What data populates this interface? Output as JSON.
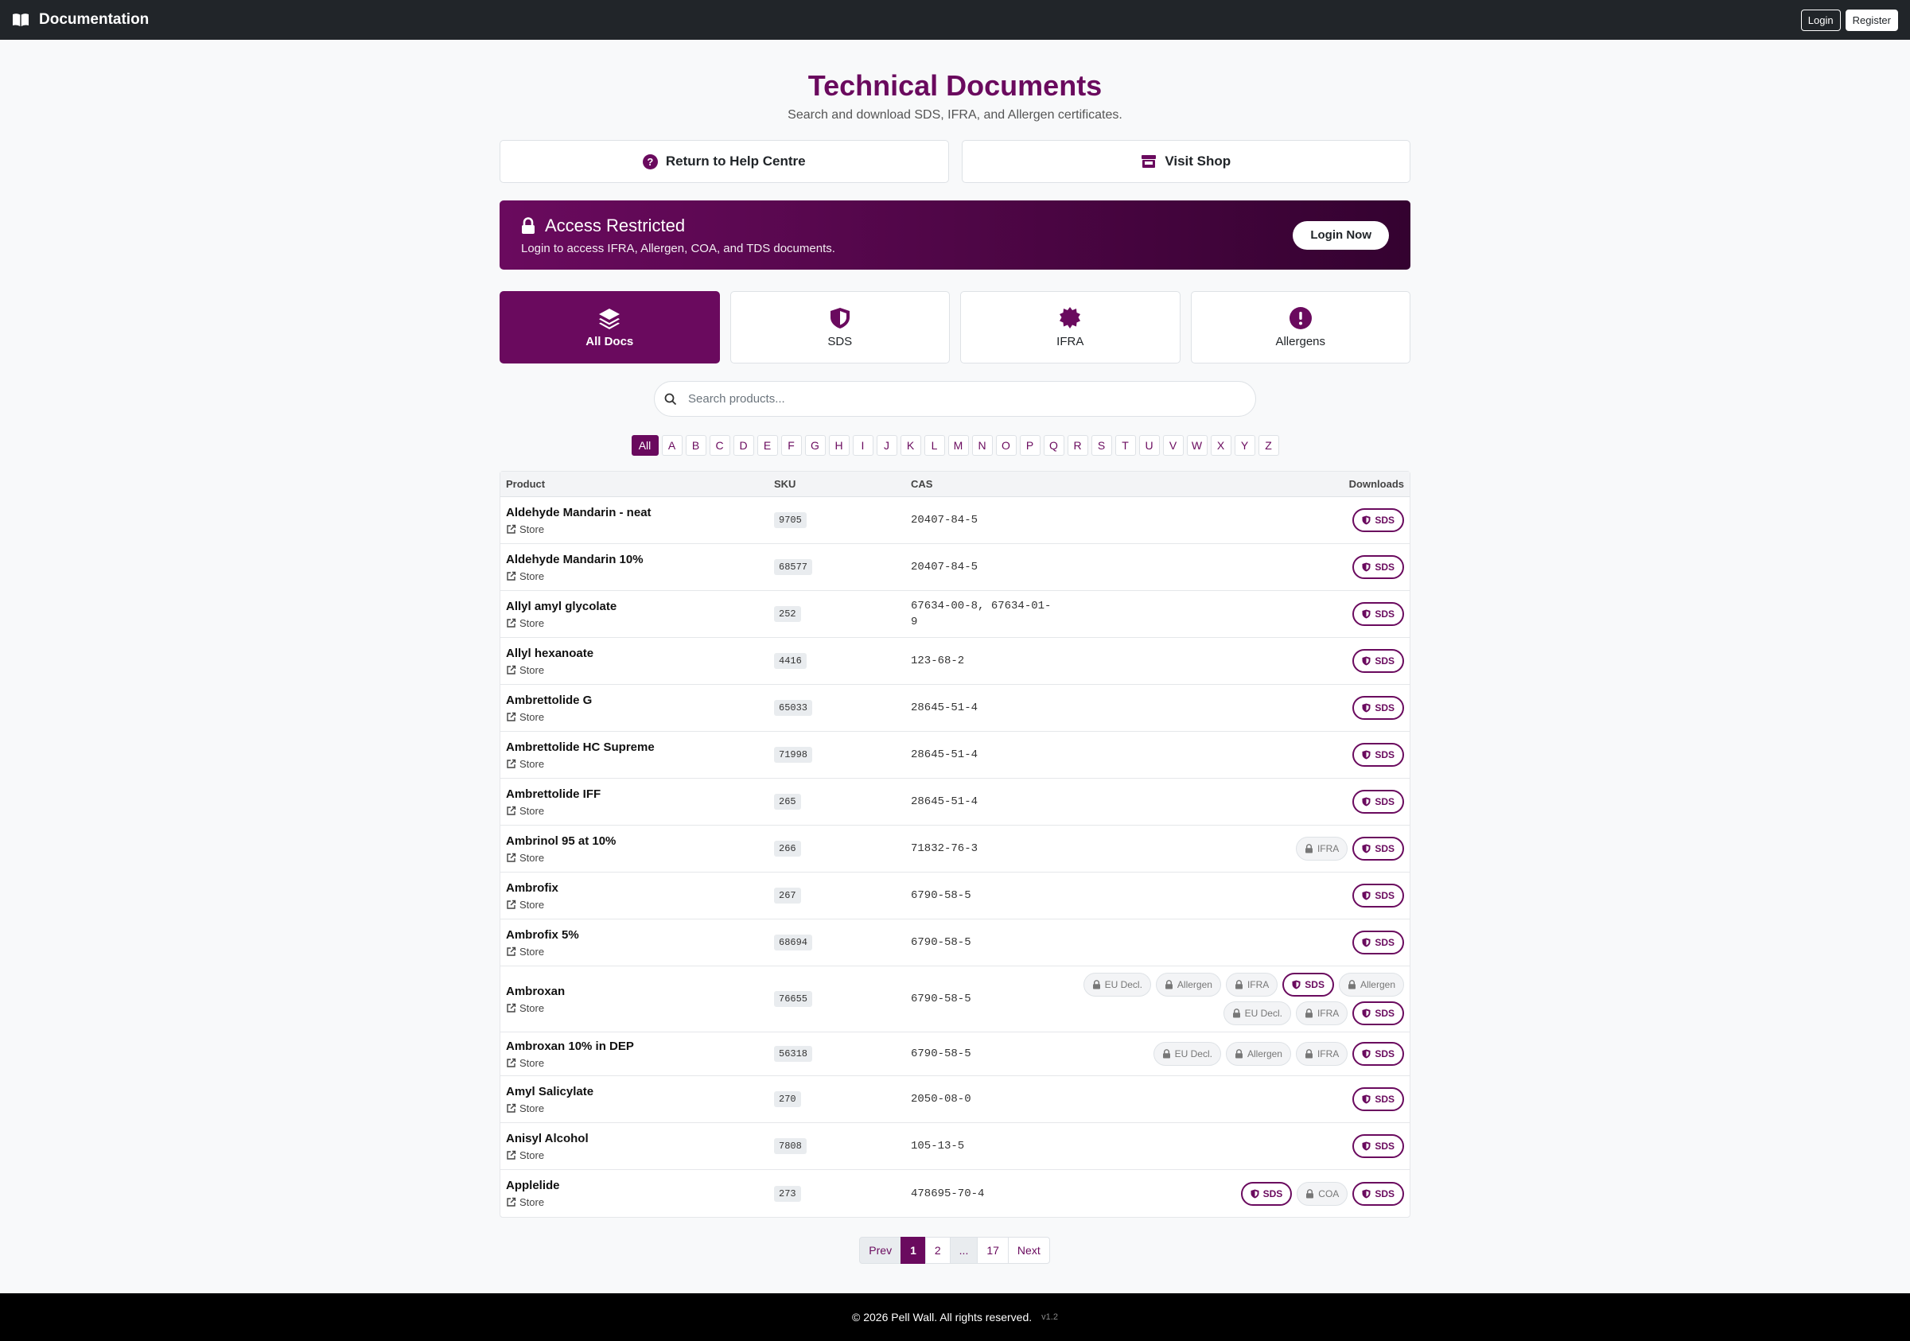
{
  "topbar": {
    "title": "Documentation",
    "login": "Login",
    "register": "Register"
  },
  "header": {
    "title": "Technical Documents",
    "subtitle": "Search and download SDS, IFRA, and Allergen certificates."
  },
  "quick_links": {
    "help": "Return to Help Centre",
    "shop": "Visit Shop"
  },
  "alert": {
    "title": "Access Restricted",
    "text": "Login to access IFRA, Allergen, COA, and TDS documents.",
    "button": "Login Now"
  },
  "doc_tabs": [
    {
      "label": "All Docs",
      "icon": "layers-icon",
      "active": true
    },
    {
      "label": "SDS",
      "icon": "shield-icon",
      "active": false
    },
    {
      "label": "IFRA",
      "icon": "certificate-icon",
      "active": false
    },
    {
      "label": "Allergens",
      "icon": "exclamation-icon",
      "active": false
    }
  ],
  "search": {
    "placeholder": "Search products..."
  },
  "alphabet": [
    "All",
    "A",
    "B",
    "C",
    "D",
    "E",
    "F",
    "G",
    "H",
    "I",
    "J",
    "K",
    "L",
    "M",
    "N",
    "O",
    "P",
    "Q",
    "R",
    "S",
    "T",
    "U",
    "V",
    "W",
    "X",
    "Y",
    "Z"
  ],
  "table": {
    "headers": {
      "product": "Product",
      "sku": "SKU",
      "cas": "CAS",
      "downloads": "Downloads"
    },
    "store_label": "Store",
    "rows": [
      {
        "name": "Aldehyde Mandarin - neat",
        "sku": "9705",
        "cas": "20407-84-5",
        "downloads": [
          "SDS"
        ]
      },
      {
        "name": "Aldehyde Mandarin 10%",
        "sku": "68577",
        "cas": "20407-84-5",
        "downloads": [
          "SDS"
        ]
      },
      {
        "name": "Allyl amyl glycolate",
        "sku": "252",
        "cas": "67634-00-8, 67634-01-9",
        "downloads": [
          "SDS"
        ]
      },
      {
        "name": "Allyl hexanoate",
        "sku": "4416",
        "cas": "123-68-2",
        "downloads": [
          "SDS"
        ]
      },
      {
        "name": "Ambrettolide G",
        "sku": "65033",
        "cas": "28645-51-4",
        "downloads": [
          "SDS"
        ]
      },
      {
        "name": "Ambrettolide HC Supreme",
        "sku": "71998",
        "cas": "28645-51-4",
        "downloads": [
          "SDS"
        ]
      },
      {
        "name": "Ambrettolide IFF",
        "sku": "265",
        "cas": "28645-51-4",
        "downloads": [
          "SDS"
        ]
      },
      {
        "name": "Ambrinol 95 at 10%",
        "sku": "266",
        "cas": "71832-76-3",
        "downloads": [
          "IFRA*",
          "SDS"
        ]
      },
      {
        "name": "Ambrofix",
        "sku": "267",
        "cas": "6790-58-5",
        "downloads": [
          "SDS"
        ]
      },
      {
        "name": "Ambrofix 5%",
        "sku": "68694",
        "cas": "6790-58-5",
        "downloads": [
          "SDS"
        ]
      },
      {
        "name": "Ambroxan",
        "sku": "76655",
        "cas": "6790-58-5",
        "downloads": [
          "EU Decl.*",
          "Allergen*",
          "IFRA*",
          "SDS",
          "Allergen*",
          "EU Decl.*",
          "IFRA*",
          "SDS"
        ]
      },
      {
        "name": "Ambroxan 10% in DEP",
        "sku": "56318",
        "cas": "6790-58-5",
        "downloads": [
          "EU Decl.*",
          "Allergen*",
          "IFRA*",
          "SDS"
        ]
      },
      {
        "name": "Amyl Salicylate",
        "sku": "270",
        "cas": "2050-08-0",
        "downloads": [
          "SDS"
        ]
      },
      {
        "name": "Anisyl Alcohol",
        "sku": "7808",
        "cas": "105-13-5",
        "downloads": [
          "SDS"
        ]
      },
      {
        "name": "Applelide",
        "sku": "273",
        "cas": "478695-70-4",
        "downloads": [
          "SDS",
          "COA*",
          "SDS"
        ]
      }
    ]
  },
  "pagination": {
    "prev": "Prev",
    "pages": [
      "1",
      "2",
      "...",
      "17"
    ],
    "current": "1",
    "next": "Next"
  },
  "footer": {
    "copyright": "© 2026 Pell Wall. All rights reserved.",
    "version": "v1.2"
  },
  "colors": {
    "brand": "#6a0a5e",
    "topbar": "#212529",
    "footer": "#000000"
  }
}
